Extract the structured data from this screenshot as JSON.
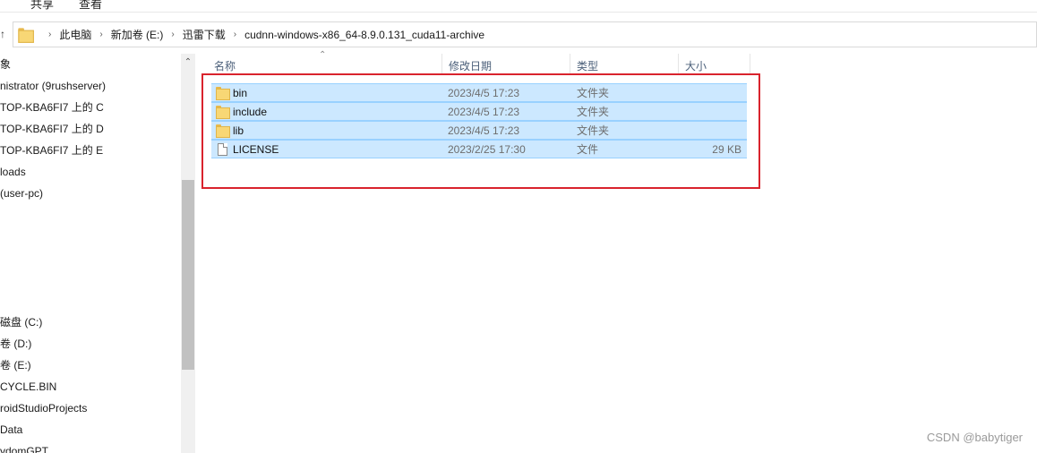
{
  "ribbon": {
    "tabs": [
      "共享",
      "查看"
    ]
  },
  "address": {
    "back_arrow": "↑",
    "crumbs": [
      "此电脑",
      "新加卷 (E:)",
      "迅雷下载",
      "cudnn-windows-x86_64-8.9.0.131_cuda11-archive"
    ]
  },
  "nav": {
    "items": [
      "象",
      "nistrator (9rushserver)",
      "TOP-KBA6FI7 上的 C",
      "TOP-KBA6FI7 上的 D",
      "TOP-KBA6FI7 上的 E",
      "loads",
      "(user-pc)",
      "磁盘 (C:)",
      "卷 (D:)",
      "卷 (E:)",
      "CYCLE.BIN",
      "roidStudioProjects",
      "Data",
      "ydomGPT"
    ]
  },
  "columns": {
    "name": "名称",
    "date": "修改日期",
    "type": "类型",
    "size": "大小"
  },
  "files": [
    {
      "name": "bin",
      "date": "2023/4/5 17:23",
      "type": "文件夹",
      "size": "",
      "icon": "folder-icon"
    },
    {
      "name": "include",
      "date": "2023/4/5 17:23",
      "type": "文件夹",
      "size": "",
      "icon": "folder-icon"
    },
    {
      "name": "lib",
      "date": "2023/4/5 17:23",
      "type": "文件夹",
      "size": "",
      "icon": "folder-icon"
    },
    {
      "name": "LICENSE",
      "date": "2023/2/25 17:30",
      "type": "文件",
      "size": "29 KB",
      "icon": "file-icon"
    }
  ],
  "colors": {
    "selection": "#cce8ff",
    "highlight_box": "#d9232d"
  },
  "watermark": "CSDN @babytiger"
}
